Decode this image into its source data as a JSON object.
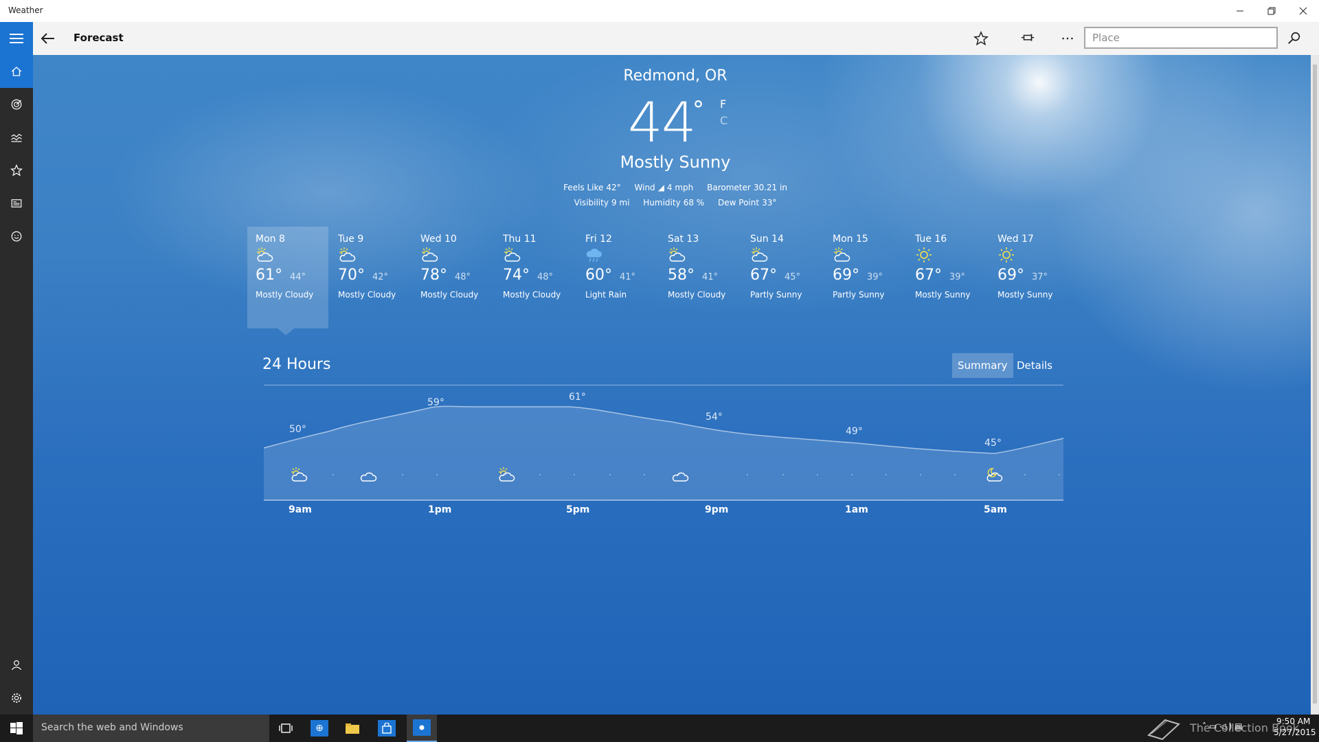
{
  "window": {
    "title": "Weather",
    "controls": [
      "minimize",
      "restore",
      "close"
    ]
  },
  "cmdbar": {
    "page_title": "Forecast",
    "search_placeholder": "Place",
    "icons": [
      "hamburger-icon",
      "back-arrow-icon",
      "star-icon",
      "pin-icon",
      "more-icon",
      "search-icon"
    ]
  },
  "nav": {
    "items": [
      "home-icon",
      "radar-icon",
      "historical-weather-icon",
      "favorites-icon",
      "news-icon",
      "life-icon"
    ],
    "bottom": [
      "account-icon",
      "settings-icon"
    ]
  },
  "current": {
    "location": "Redmond, OR",
    "temp": "44",
    "degree": "°",
    "unit_f": "F",
    "unit_c": "C",
    "condition": "Mostly Sunny",
    "feels_like_label": "Feels Like",
    "feels_like": "42°",
    "wind_label": "Wind",
    "wind": "4 mph",
    "barometer_label": "Barometer",
    "barometer": "30.21 in",
    "visibility_label": "Visibility",
    "visibility": "9 mi",
    "humidity_label": "Humidity",
    "humidity": "68 %",
    "dew_point_label": "Dew Point",
    "dew_point": "33°"
  },
  "forecast": [
    {
      "day": "Mon 8",
      "hi": "61°",
      "lo": "44°",
      "cond": "Mostly Cloudy",
      "icon": "partly-cloudy-icon"
    },
    {
      "day": "Tue 9",
      "hi": "70°",
      "lo": "42°",
      "cond": "Mostly Cloudy",
      "icon": "partly-cloudy-icon"
    },
    {
      "day": "Wed 10",
      "hi": "78°",
      "lo": "48°",
      "cond": "Mostly Cloudy",
      "icon": "partly-cloudy-icon"
    },
    {
      "day": "Thu 11",
      "hi": "74°",
      "lo": "48°",
      "cond": "Mostly Cloudy",
      "icon": "partly-cloudy-icon"
    },
    {
      "day": "Fri 12",
      "hi": "60°",
      "lo": "41°",
      "cond": "Light Rain",
      "icon": "rain-icon"
    },
    {
      "day": "Sat 13",
      "hi": "58°",
      "lo": "41°",
      "cond": "Mostly Cloudy",
      "icon": "partly-cloudy-icon"
    },
    {
      "day": "Sun 14",
      "hi": "67°",
      "lo": "45°",
      "cond": "Partly Sunny",
      "icon": "partly-sunny-icon"
    },
    {
      "day": "Mon 15",
      "hi": "69°",
      "lo": "39°",
      "cond": "Partly Sunny",
      "icon": "partly-sunny-icon"
    },
    {
      "day": "Tue 16",
      "hi": "67°",
      "lo": "39°",
      "cond": "Mostly Sunny",
      "icon": "sun-icon"
    },
    {
      "day": "Wed 17",
      "hi": "69°",
      "lo": "37°",
      "cond": "Mostly Sunny",
      "icon": "sun-icon"
    }
  ],
  "hours": {
    "title": "24 Hours",
    "summary_label": "Summary",
    "details_label": "Details",
    "labels": [
      "9am",
      "1pm",
      "5pm",
      "9pm",
      "1am",
      "5am"
    ],
    "temps": [
      "50°",
      "59°",
      "61°",
      "54°",
      "49°",
      "45°"
    ],
    "icons": [
      "partly-sunny-icon",
      "cloud-icon",
      "partly-sunny-icon",
      "cloud-icon",
      "partly-cloudy-night-icon"
    ]
  },
  "taskbar": {
    "search_placeholder": "Search the web and Windows",
    "watermark": "The Collection Book",
    "time": "9:50 AM",
    "date": "5/27/2015"
  },
  "colors": {
    "accent": "#1c74d2",
    "sky_top": "#3f86c8",
    "sky_bottom": "#1f63b7",
    "nav_bg": "#2b2b2b",
    "taskbar_bg": "#1b1b1b",
    "sun_yellow": "#f7e34a"
  }
}
